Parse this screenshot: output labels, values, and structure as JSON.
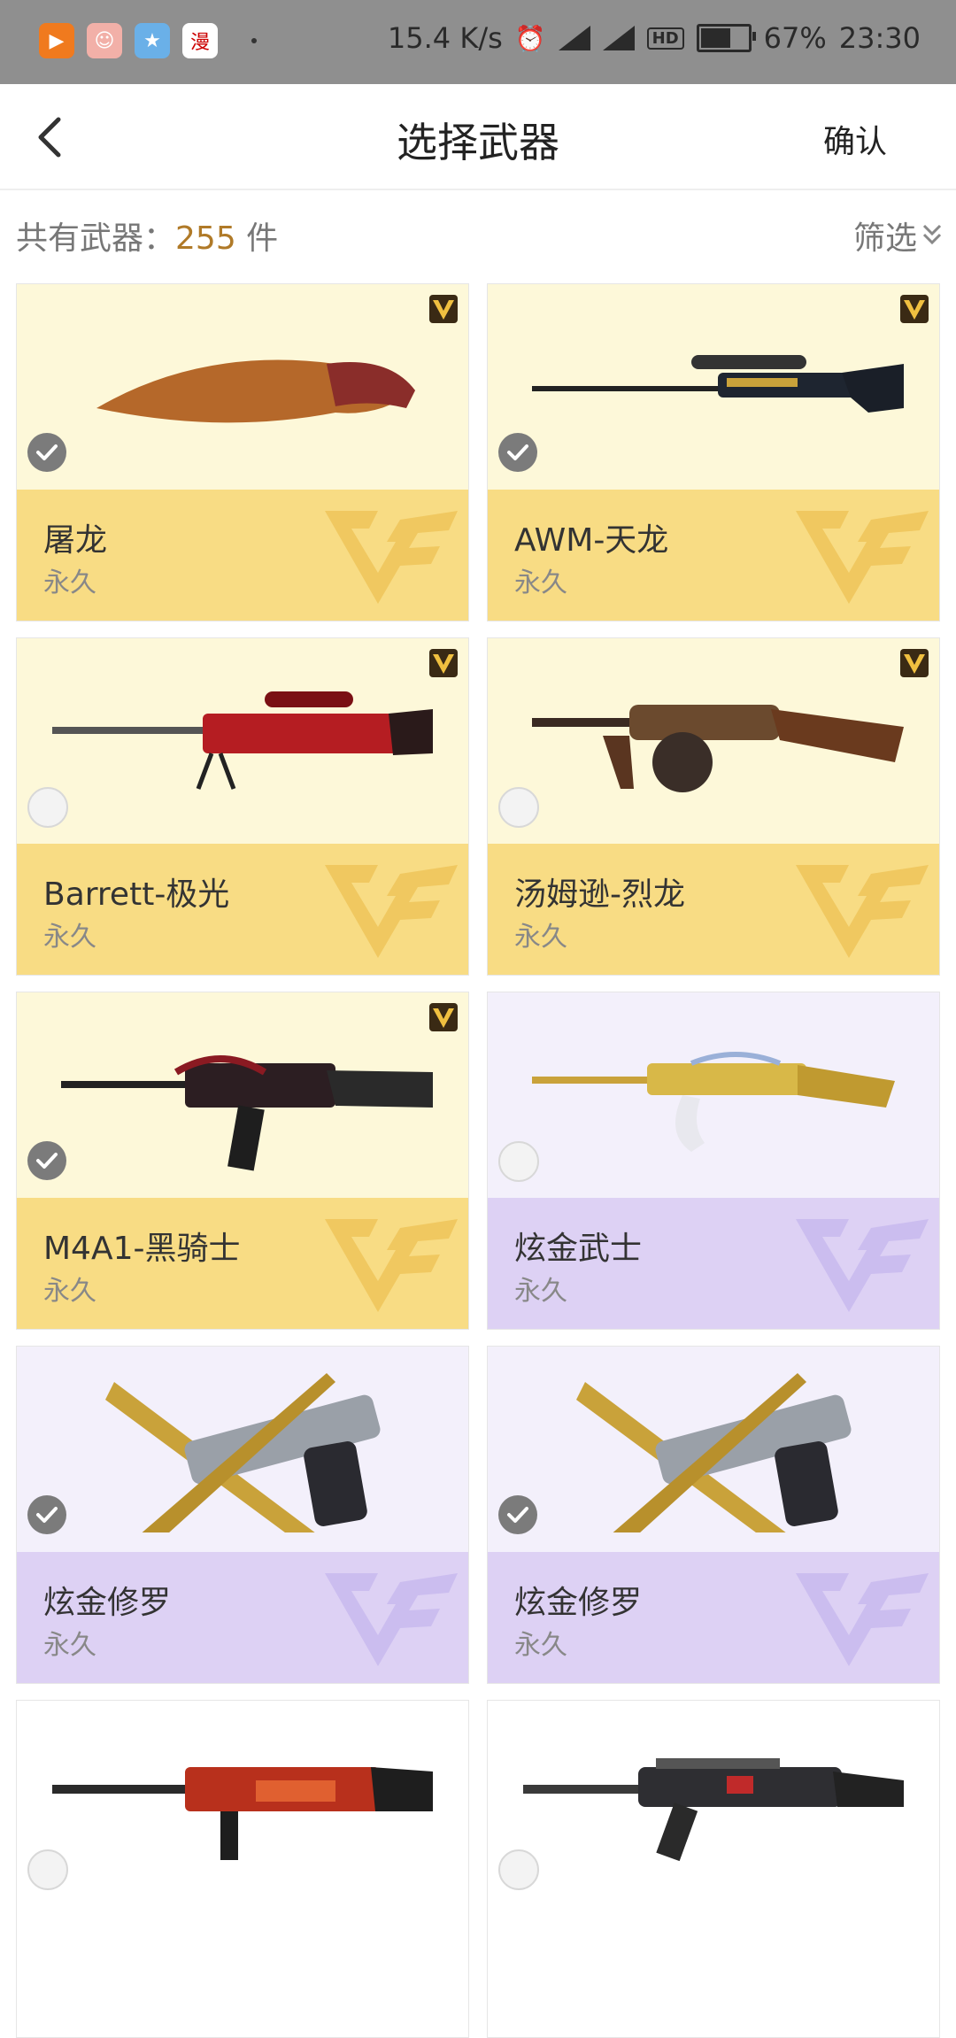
{
  "status_bar": {
    "net_speed": "15.4 K/s",
    "battery_pct": "67%",
    "battery_level": 0.67,
    "time": "23:30",
    "hd_label": "HD",
    "net1": "4G",
    "net2": "4G"
  },
  "header": {
    "title": "选择武器",
    "confirm_label": "确认"
  },
  "summary": {
    "prefix": "共有武器：",
    "count": "255",
    "unit": " 件",
    "filter_label": "筛选"
  },
  "colors": {
    "gold_top": "#fdf8d9",
    "gold_bottom": "#f8dc84",
    "purple_top": "#f3f0fb",
    "purple_bottom": "#ddd1f4",
    "count_accent": "#b07a28"
  },
  "weapons": [
    {
      "name": "屠龙",
      "duration": "永久",
      "selected": true,
      "tier": "gold",
      "vip": true,
      "icon": "kukri-knife-icon"
    },
    {
      "name": "AWM-天龙",
      "duration": "永久",
      "selected": true,
      "tier": "gold",
      "vip": true,
      "icon": "sniper-rifle-icon"
    },
    {
      "name": "Barrett-极光",
      "duration": "永久",
      "selected": false,
      "tier": "gold",
      "vip": true,
      "icon": "heavy-sniper-icon"
    },
    {
      "name": "汤姆逊-烈龙",
      "duration": "永久",
      "selected": false,
      "tier": "gold",
      "vip": true,
      "icon": "tommy-gun-icon"
    },
    {
      "name": "M4A1-黑骑士",
      "duration": "永久",
      "selected": true,
      "tier": "gold",
      "vip": true,
      "icon": "assault-rifle-icon"
    },
    {
      "name": "炫金武士",
      "duration": "永久",
      "selected": false,
      "tier": "purple",
      "vip": false,
      "icon": "ak-rifle-icon"
    },
    {
      "name": "炫金修罗",
      "duration": "永久",
      "selected": true,
      "tier": "purple",
      "vip": false,
      "icon": "pistol-blade-icon"
    },
    {
      "name": "炫金修罗",
      "duration": "永久",
      "selected": true,
      "tier": "purple",
      "vip": false,
      "icon": "pistol-blade-icon"
    },
    {
      "name": "",
      "duration": "",
      "selected": false,
      "tier": "plain",
      "vip": false,
      "icon": "shotgun-icon"
    },
    {
      "name": "",
      "duration": "",
      "selected": false,
      "tier": "plain",
      "vip": false,
      "icon": "smg-icon"
    }
  ]
}
